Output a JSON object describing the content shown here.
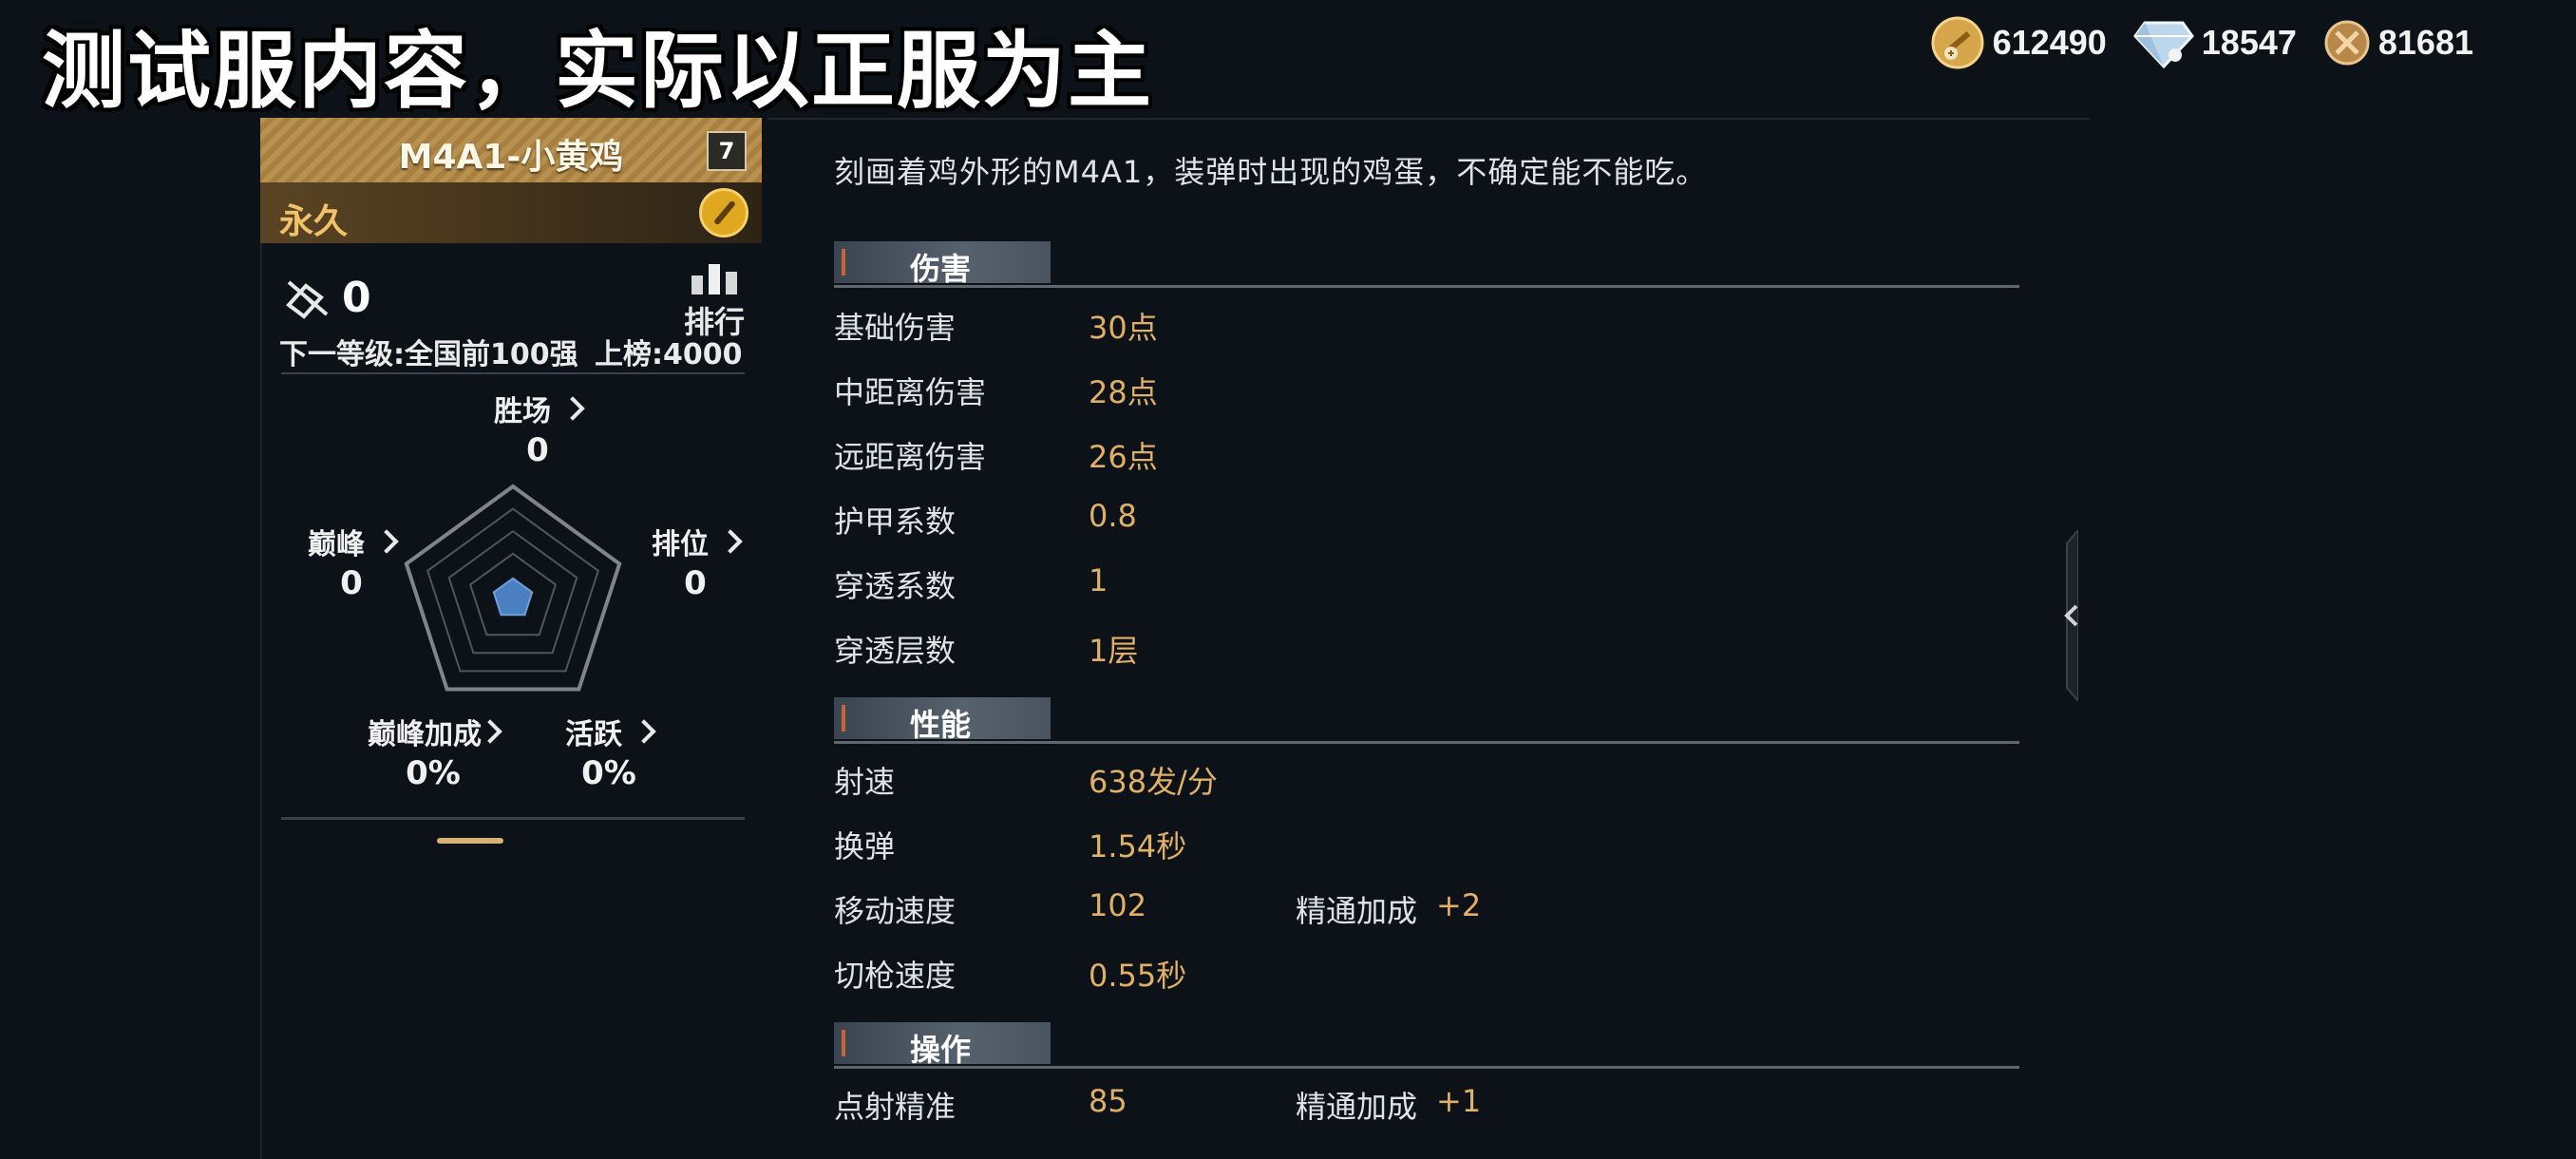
{
  "banner": "测试服内容，实际以正服为主",
  "currencies": [
    {
      "icon": "gold-coin-icon",
      "value": "612490"
    },
    {
      "icon": "diamond-icon",
      "value": "18547"
    },
    {
      "icon": "medal-coin-icon",
      "value": "81681"
    }
  ],
  "weapon": {
    "name": "M4A1-小黄鸡",
    "level": "7",
    "duration": "永久"
  },
  "rank": {
    "value": "0",
    "button_label": "排行",
    "next_level": "下一等级:全国前100强",
    "on_list": "上榜:4000"
  },
  "radar": {
    "wins": {
      "label": "胜场",
      "value": "0"
    },
    "ranked": {
      "label": "排位",
      "value": "0"
    },
    "peak": {
      "label": "巅峰",
      "value": "0"
    },
    "peak_bonus": {
      "label": "巅峰加成",
      "value": "0%"
    },
    "active": {
      "label": "活跃",
      "value": "0%"
    },
    "fill_fraction": 0.18
  },
  "description": "刻画着鸡外形的M4A1，装弹时出现的鸡蛋，不确定能不能吃。",
  "sections": {
    "damage": {
      "title": "伤害",
      "rows": [
        {
          "k": "基础伤害",
          "v": "30点"
        },
        {
          "k": "中距离伤害",
          "v": "28点"
        },
        {
          "k": "远距离伤害",
          "v": "26点"
        },
        {
          "k": "护甲系数",
          "v": "0.8"
        },
        {
          "k": "穿透系数",
          "v": "1"
        },
        {
          "k": "穿透层数",
          "v": "1层"
        }
      ]
    },
    "performance": {
      "title": "性能",
      "rows": [
        {
          "k": "射速",
          "v": "638发/分"
        },
        {
          "k": "换弹",
          "v": "1.54秒"
        },
        {
          "k": "移动速度",
          "v": "102",
          "mk": "精通加成",
          "mv": "+2"
        },
        {
          "k": "切枪速度",
          "v": "0.55秒"
        }
      ]
    },
    "handling": {
      "title": "操作",
      "rows": [
        {
          "k": "点射精准",
          "v": "85",
          "mk": "精通加成",
          "mv": "+1"
        }
      ]
    }
  }
}
